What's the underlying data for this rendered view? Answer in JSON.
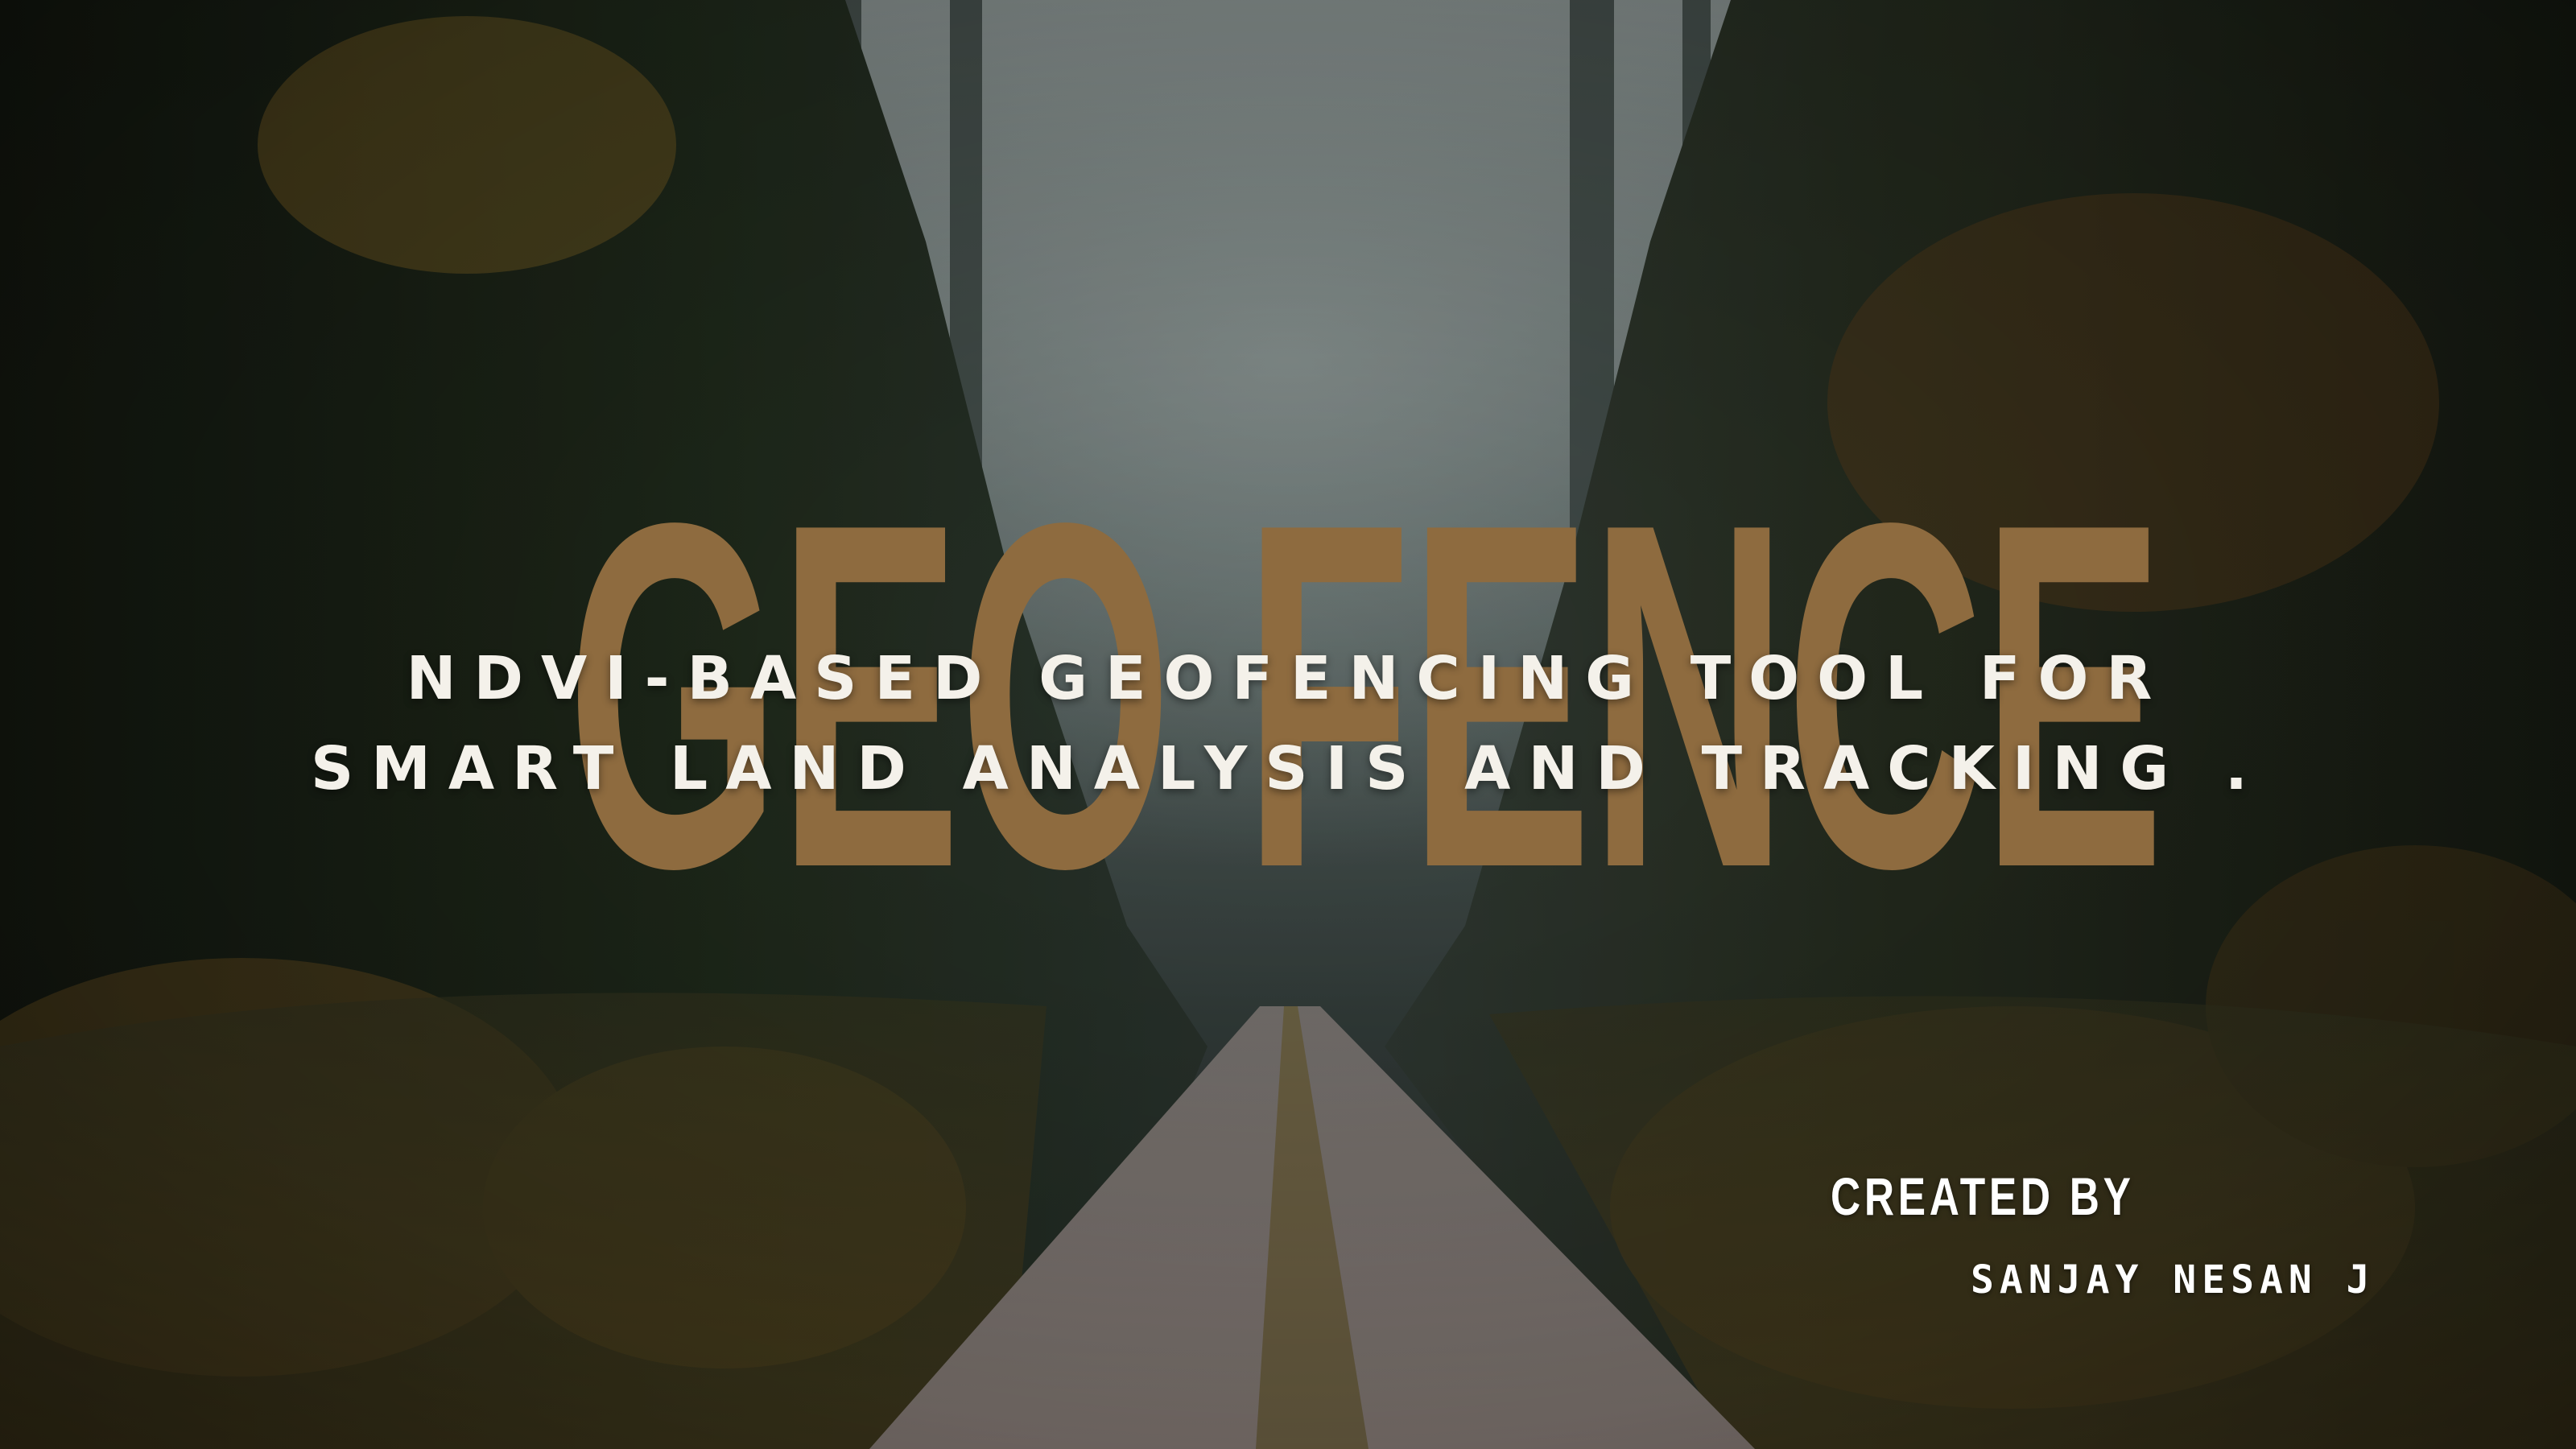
{
  "slide": {
    "title": "GEO FENCE",
    "subtitle_line1": "NDVI-BASED GEOFENCING TOOL FOR",
    "subtitle_line2": "SMART LAND ANALYSIS AND TRACKING .",
    "created_by_label": "CREATED BY",
    "author_name": "SANJAY NESAN J"
  },
  "background": {
    "description_icon": "forest-road-photo-icon",
    "colors": {
      "title": "#8e6b3f",
      "text": "#f4f1ea",
      "fog": "#5d6b69",
      "road": "#9a8e88",
      "foliage_dark": "#1f2619",
      "foliage_autumn": "#8a6a2c"
    }
  }
}
